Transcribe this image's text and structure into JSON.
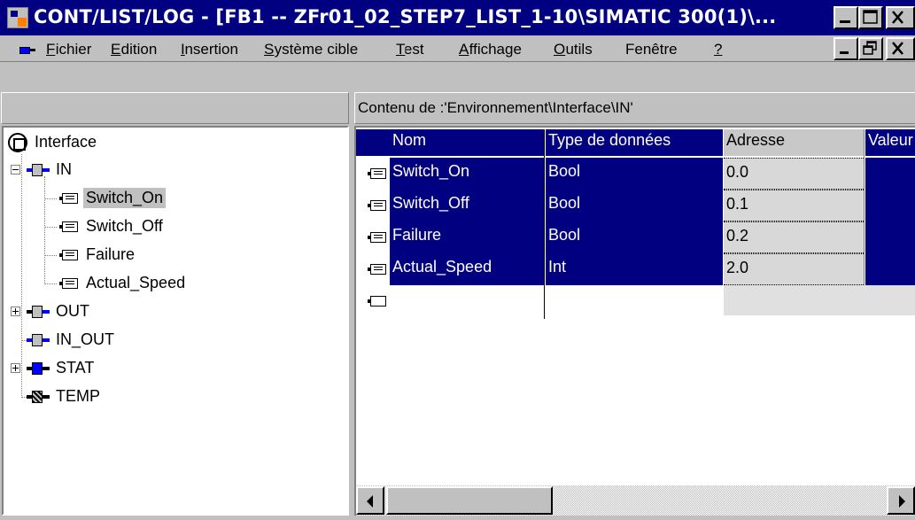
{
  "window": {
    "title": "CONT/LIST/LOG - [FB1 -- ZFr01_02_STEP7_LIST_1-10\\SIMATIC 300(1)\\...",
    "icon": "simatic-app-icon"
  },
  "menu": {
    "items": [
      {
        "label": "Fichier",
        "mnemonic": "F"
      },
      {
        "label": "Edition",
        "mnemonic": "E"
      },
      {
        "label": "Insertion",
        "mnemonic": "I"
      },
      {
        "label": "Système cible",
        "mnemonic": "S"
      },
      {
        "label": "Test",
        "mnemonic": "T"
      },
      {
        "label": "Affichage",
        "mnemonic": "A"
      },
      {
        "label": "Outils",
        "mnemonic": "O"
      },
      {
        "label": "Fenêtre",
        "mnemonic": "n"
      },
      {
        "label": "?",
        "mnemonic": "?"
      }
    ]
  },
  "right_panel": {
    "header": "Contenu de :'Environnement\\Interface\\IN'"
  },
  "tree": {
    "root": "Interface",
    "nodes": [
      {
        "label": "IN",
        "expander": "-",
        "icon": "input-param-icon"
      },
      {
        "label": "Switch_On",
        "selected": true,
        "icon": "variable-icon"
      },
      {
        "label": "Switch_Off",
        "icon": "variable-icon"
      },
      {
        "label": "Failure",
        "icon": "variable-icon"
      },
      {
        "label": "Actual_Speed",
        "icon": "variable-icon"
      },
      {
        "label": "OUT",
        "expander": "+",
        "icon": "output-param-icon"
      },
      {
        "label": "IN_OUT",
        "icon": "inout-param-icon"
      },
      {
        "label": "STAT",
        "expander": "+",
        "icon": "static-param-icon"
      },
      {
        "label": "TEMP",
        "icon": "temp-param-icon"
      }
    ]
  },
  "table": {
    "columns": [
      "Nom",
      "Type de données",
      "Adresse",
      "Valeur"
    ],
    "rows": [
      {
        "name": "Switch_On",
        "type": "Bool",
        "address": "0.0"
      },
      {
        "name": "Switch_Off",
        "type": "Bool",
        "address": "0.1"
      },
      {
        "name": "Failure",
        "type": "Bool",
        "address": "0.2"
      },
      {
        "name": "Actual_Speed",
        "type": "Int",
        "address": "2.0"
      }
    ]
  },
  "colors": {
    "title_bg": "#000080",
    "selection_bg": "#000080",
    "window_bg": "#c0c0c0"
  }
}
